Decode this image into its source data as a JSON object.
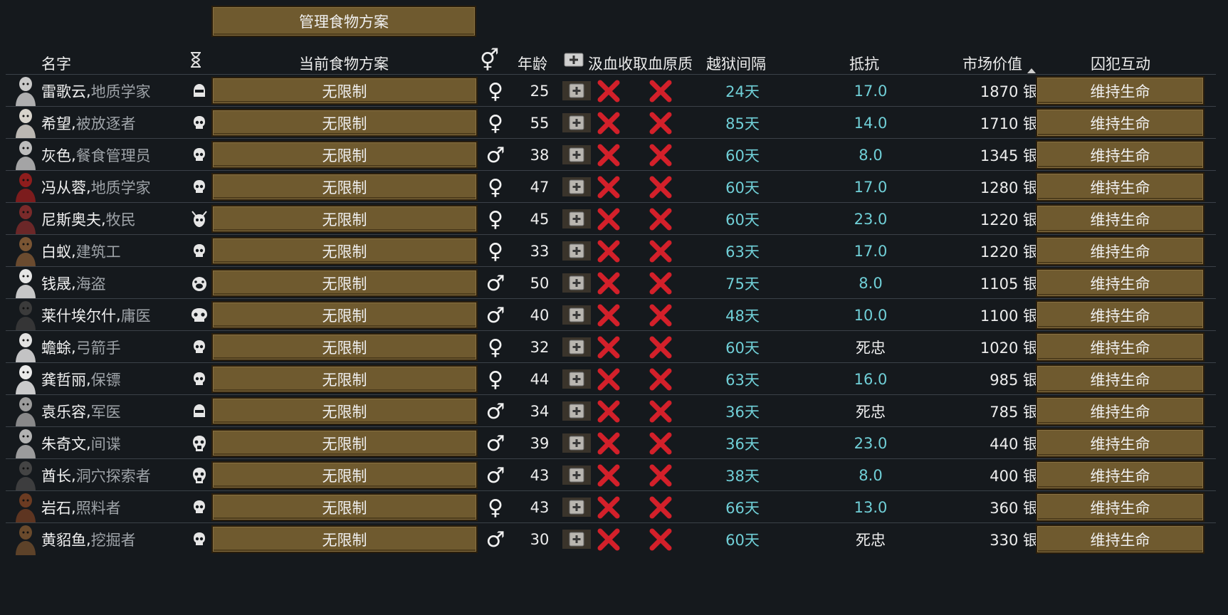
{
  "top_button": {
    "label": "管理食物方案"
  },
  "headers": {
    "name": "名字",
    "food_policy": "当前食物方案",
    "age": "年龄",
    "hemogen": "汲血收取血原质",
    "escape": "越狱间隔",
    "resistance": "抵抗",
    "market_value": "市场价值",
    "interaction": "囚犯互动"
  },
  "colors": {
    "background": "#15191d",
    "button_brown": "#6f5a2f",
    "cyan_text": "#70cfd7",
    "red_x": "#d3202a"
  },
  "rows": [
    {
      "name": "雷歌云",
      "sep": ", ",
      "title": "地质学家",
      "mask": "helmet-icon",
      "food": "无限制",
      "gender": "female",
      "age": "25",
      "escape": "24天",
      "resistance": "17.0",
      "resist_cyan": true,
      "value": "1870 银",
      "interaction": "维持生命"
    },
    {
      "name": "希望",
      "sep": ", ",
      "title": "被放逐者",
      "mask": "skull-icon",
      "food": "无限制",
      "gender": "female",
      "age": "55",
      "escape": "85天",
      "resistance": "14.0",
      "resist_cyan": true,
      "value": "1710 银",
      "interaction": "维持生命"
    },
    {
      "name": "灰色",
      "sep": ", ",
      "title": "餐食管理员",
      "mask": "skull-icon",
      "food": "无限制",
      "gender": "male",
      "age": "38",
      "escape": "60天",
      "resistance": "8.0",
      "resist_cyan": true,
      "value": "1345 银",
      "interaction": "维持生命"
    },
    {
      "name": "冯从蓉",
      "sep": ", ",
      "title": "地质学家",
      "mask": "skull-icon",
      "food": "无限制",
      "gender": "female",
      "age": "47",
      "escape": "60天",
      "resistance": "17.0",
      "resist_cyan": true,
      "value": "1280 银",
      "interaction": "维持生命"
    },
    {
      "name": "尼斯奥夫",
      "sep": ", ",
      "title": "牧民",
      "mask": "impid-icon",
      "food": "无限制",
      "gender": "female",
      "age": "45",
      "escape": "60天",
      "resistance": "23.0",
      "resist_cyan": true,
      "value": "1220 银",
      "interaction": "维持生命"
    },
    {
      "name": "白蚁",
      "sep": ", ",
      "title": "建筑工",
      "mask": "skull-icon",
      "food": "无限制",
      "gender": "female",
      "age": "33",
      "escape": "63天",
      "resistance": "17.0",
      "resist_cyan": true,
      "value": "1220 银",
      "interaction": "维持生命"
    },
    {
      "name": "钱晟",
      "sep": ", ",
      "title": "海盗",
      "mask": "pig-icon",
      "food": "无限制",
      "gender": "male",
      "age": "50",
      "escape": "75天",
      "resistance": "8.0",
      "resist_cyan": true,
      "value": "1105 银",
      "interaction": "维持生命"
    },
    {
      "name": "莱什埃尔什",
      "sep": ", ",
      "title": "庸医",
      "mask": "wide-skull-icon",
      "food": "无限制",
      "gender": "male",
      "age": "40",
      "escape": "48天",
      "resistance": "10.0",
      "resist_cyan": true,
      "value": "1100 银",
      "interaction": "维持生命"
    },
    {
      "name": "蟾蜍",
      "sep": ", ",
      "title": "弓箭手",
      "mask": "skull-icon",
      "food": "无限制",
      "gender": "female",
      "age": "32",
      "escape": "60天",
      "resistance": "死忠",
      "resist_cyan": false,
      "value": "1020 银",
      "interaction": "维持生命"
    },
    {
      "name": "龚哲丽",
      "sep": ", ",
      "title": "保镖",
      "mask": "skull-icon",
      "food": "无限制",
      "gender": "female",
      "age": "44",
      "escape": "63天",
      "resistance": "16.0",
      "resist_cyan": true,
      "value": "985 银",
      "interaction": "维持生命"
    },
    {
      "name": "袁乐容",
      "sep": ", ",
      "title": "军医",
      "mask": "helmet-icon",
      "food": "无限制",
      "gender": "male",
      "age": "34",
      "escape": "36天",
      "resistance": "死忠",
      "resist_cyan": false,
      "value": "785 银",
      "interaction": "维持生命"
    },
    {
      "name": "朱奇文",
      "sep": ", ",
      "title": "间谍",
      "mask": "gasmask-icon",
      "food": "无限制",
      "gender": "male",
      "age": "39",
      "escape": "36天",
      "resistance": "23.0",
      "resist_cyan": true,
      "value": "440 银",
      "interaction": "维持生命"
    },
    {
      "name": "酋长",
      "sep": ", ",
      "title": "洞穴探索者",
      "mask": "gasmask-icon",
      "food": "无限制",
      "gender": "male",
      "age": "43",
      "escape": "38天",
      "resistance": "8.0",
      "resist_cyan": true,
      "value": "400 银",
      "interaction": "维持生命"
    },
    {
      "name": "岩石",
      "sep": ", ",
      "title": "照料者",
      "mask": "skull-icon",
      "food": "无限制",
      "gender": "female",
      "age": "43",
      "escape": "66天",
      "resistance": "13.0",
      "resist_cyan": true,
      "value": "360 银",
      "interaction": "维持生命"
    },
    {
      "name": "黄貂鱼",
      "sep": ", ",
      "title": "挖掘者",
      "mask": "skull-icon",
      "food": "无限制",
      "gender": "male",
      "age": "30",
      "escape": "60天",
      "resistance": "死忠",
      "resist_cyan": false,
      "value": "330 银",
      "interaction": "维持生命"
    }
  ]
}
